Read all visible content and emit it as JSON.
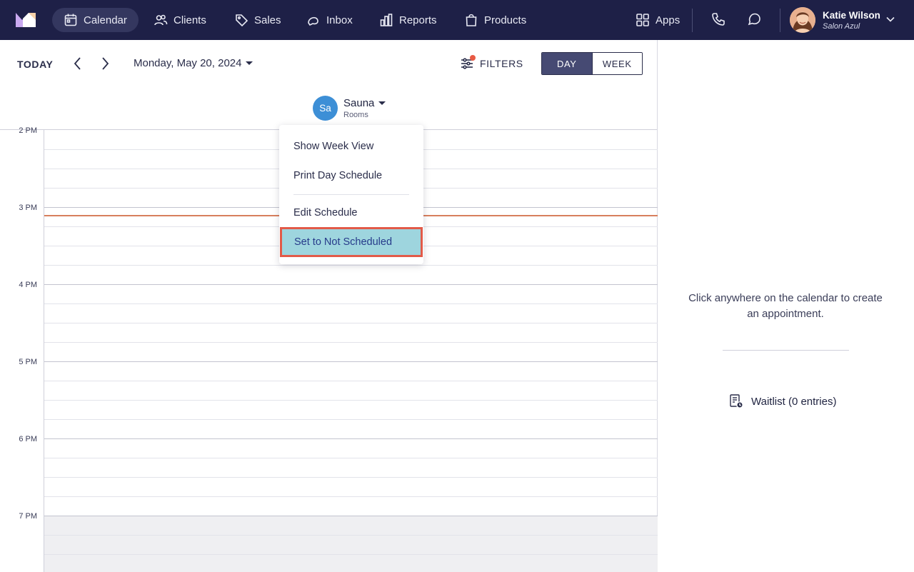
{
  "nav": {
    "items": [
      {
        "label": "Calendar",
        "icon": "calendar-icon",
        "active": true
      },
      {
        "label": "Clients",
        "icon": "users-icon"
      },
      {
        "label": "Sales",
        "icon": "tag-icon"
      },
      {
        "label": "Inbox",
        "icon": "chat-bubbles-icon"
      },
      {
        "label": "Reports",
        "icon": "bar-chart-icon"
      },
      {
        "label": "Products",
        "icon": "shopping-bag-icon"
      }
    ],
    "apps_label": "Apps",
    "user": {
      "name": "Katie Wilson",
      "business": "Salon Azul"
    }
  },
  "toolbar": {
    "today_label": "TODAY",
    "date_label": "Monday, May 20, 2024",
    "filters_label": "FILTERS",
    "view_day": "DAY",
    "view_week": "WEEK"
  },
  "resource": {
    "initials": "Sa",
    "name": "Sauna",
    "type": "Rooms"
  },
  "time_labels": [
    "2 PM",
    "3 PM",
    "4 PM",
    "5 PM",
    "6 PM",
    "7 PM"
  ],
  "menu": {
    "items": [
      "Show Week View",
      "Print Day Schedule",
      "Edit Schedule",
      "Set to Not Scheduled"
    ],
    "highlighted": "Set to Not Scheduled"
  },
  "side": {
    "empty_message": "Click anywhere on the calendar to create an appointment.",
    "waitlist_label": "Waitlist (0 entries)"
  },
  "colors": {
    "nav_bg": "#1e2047",
    "now_line": "#d87f5d",
    "highlight": "#9ed5de",
    "highlight_border": "#e25a48",
    "resource_avatar": "#3d8fd6"
  }
}
